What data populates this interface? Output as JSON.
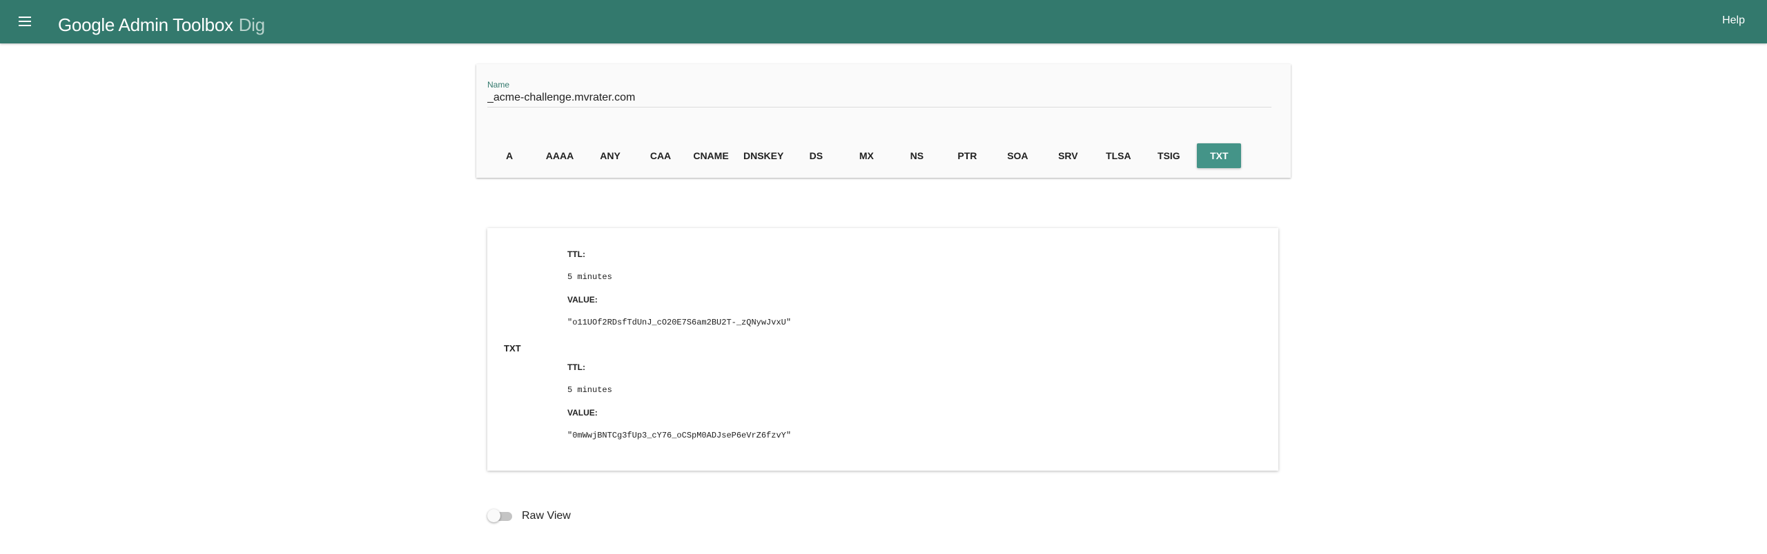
{
  "header": {
    "brand": "Google Admin Toolbox",
    "app": "Dig",
    "help_label": "Help",
    "menu_icon": "hamburger-menu-icon",
    "background_color": "#33796d"
  },
  "query": {
    "name_label": "Name",
    "name_value": "_acme-challenge.mvrater.com",
    "record_types": [
      {
        "label": "A",
        "selected": false
      },
      {
        "label": "AAAA",
        "selected": false
      },
      {
        "label": "ANY",
        "selected": false
      },
      {
        "label": "CAA",
        "selected": false
      },
      {
        "label": "CNAME",
        "selected": false
      },
      {
        "label": "DNSKEY",
        "selected": false
      },
      {
        "label": "DS",
        "selected": false
      },
      {
        "label": "MX",
        "selected": false
      },
      {
        "label": "NS",
        "selected": false
      },
      {
        "label": "PTR",
        "selected": false
      },
      {
        "label": "SOA",
        "selected": false
      },
      {
        "label": "SRV",
        "selected": false
      },
      {
        "label": "TLSA",
        "selected": false
      },
      {
        "label": "TSIG",
        "selected": false
      },
      {
        "label": "TXT",
        "selected": true
      }
    ],
    "accent_color": "#449488"
  },
  "results": {
    "record_type": "TXT",
    "records": [
      {
        "ttl_label": "TTL:",
        "ttl": "5 minutes",
        "value_label": "VALUE:",
        "value": "\"o11UOf2RDsfTdUnJ_cO20E7S6am2BU2T-_zQNywJvxU\""
      },
      {
        "ttl_label": "TTL:",
        "ttl": "5 minutes",
        "value_label": "VALUE:",
        "value": "\"0mWwjBNTCg3fUp3_cY76_oCSpM0ADJseP6eVrZ6fzvY\""
      }
    ]
  },
  "raw_view": {
    "label": "Raw View",
    "enabled": false
  }
}
